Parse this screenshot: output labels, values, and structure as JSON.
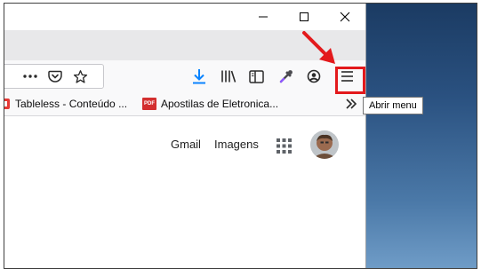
{
  "window": {
    "minimize_icon": "minimize-icon",
    "maximize_icon": "maximize-icon",
    "close_icon": "close-icon"
  },
  "navbar": {
    "page_actions_icon": "more-horizontal-icon",
    "pocket_icon": "pocket-icon",
    "bookmark_star_icon": "star-icon",
    "downloads_icon": "download-icon",
    "library_icon": "library-icon",
    "sidebar_icon": "sidebar-icon",
    "eyedropper_icon": "eyedropper-icon",
    "account_icon": "account-icon",
    "menu_icon": "hamburger-menu-icon"
  },
  "bookmarks": {
    "items": [
      {
        "label": "Tableless - Conteúdo ...",
        "icon": "site-favicon"
      },
      {
        "label": "Apostilas de Eletronica...",
        "icon": "pdf-icon",
        "icon_text": "PDF"
      }
    ],
    "overflow_icon": "chevron-double-right-icon"
  },
  "content": {
    "gmail_label": "Gmail",
    "images_label": "Imagens",
    "apps_icon": "apps-grid-icon",
    "avatar": "user-avatar"
  },
  "tooltip": {
    "text": "Abrir menu"
  },
  "annotation": {
    "arrow_color": "#e3191c",
    "highlight_color": "#e3191c"
  },
  "colors": {
    "download_blue": "#0a84ff",
    "pdf_red": "#d32f2f"
  }
}
